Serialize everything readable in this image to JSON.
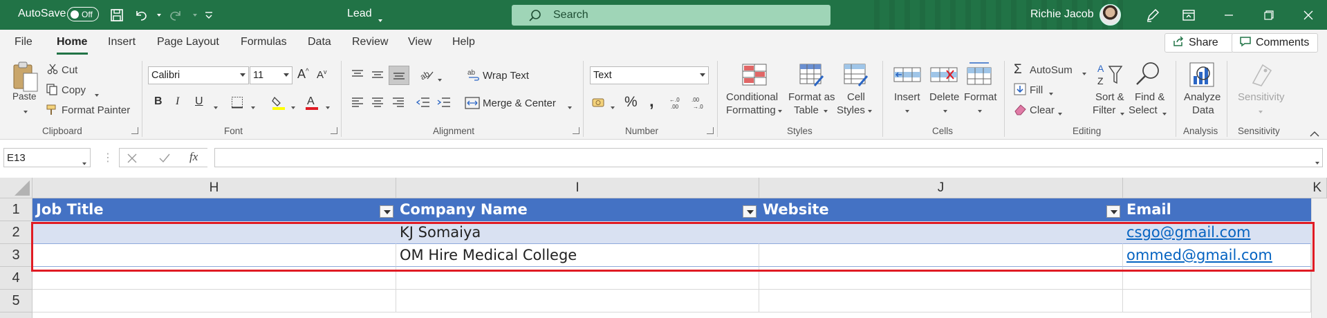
{
  "titlebar": {
    "autosave_label": "AutoSave",
    "autosave_state": "Off",
    "document_title": "Lead",
    "search_placeholder": "Search",
    "user_name": "Richie Jacob",
    "accent_color": "#217346"
  },
  "tabs": [
    "File",
    "Home",
    "Insert",
    "Page Layout",
    "Formulas",
    "Data",
    "Review",
    "View",
    "Help"
  ],
  "active_tab": "Home",
  "share_label": "Share",
  "comments_label": "Comments",
  "ribbon": {
    "clipboard": {
      "title": "Clipboard",
      "paste": "Paste",
      "cut": "Cut",
      "copy": "Copy",
      "format_painter": "Format Painter"
    },
    "font": {
      "title": "Font",
      "font_name": "Calibri",
      "font_size": "11"
    },
    "alignment": {
      "title": "Alignment",
      "wrap_text": "Wrap Text",
      "merge_center": "Merge & Center"
    },
    "number": {
      "title": "Number",
      "format": "Text"
    },
    "styles": {
      "title": "Styles",
      "conditional_1": "Conditional",
      "conditional_2": "Formatting",
      "format_table_1": "Format as",
      "format_table_2": "Table",
      "cell_styles_1": "Cell",
      "cell_styles_2": "Styles"
    },
    "cells": {
      "title": "Cells",
      "insert": "Insert",
      "delete": "Delete",
      "format": "Format"
    },
    "editing": {
      "title": "Editing",
      "autosum": "AutoSum",
      "fill": "Fill",
      "clear": "Clear",
      "sort_1": "Sort &",
      "sort_2": "Filter",
      "find_1": "Find &",
      "find_2": "Select"
    },
    "analysis": {
      "title": "Analysis",
      "analyze_1": "Analyze",
      "analyze_2": "Data"
    },
    "sensitivity": {
      "title": "Sensitivity",
      "label": "Sensitivity"
    }
  },
  "formula_bar": {
    "name_box": "E13",
    "formula": ""
  },
  "grid": {
    "columns": [
      "H",
      "I",
      "J",
      "K"
    ],
    "rows": [
      "1",
      "2",
      "3",
      "4",
      "5"
    ],
    "header_row": [
      "Job Title",
      "Company Name",
      "Website",
      "Email"
    ],
    "data_rows": [
      [
        "",
        "KJ Somaiya",
        "",
        "csgo@gmail.com"
      ],
      [
        "",
        "OM Hire Medical College",
        "",
        "ommed@gmail.com"
      ]
    ],
    "table_header_color": "#4472c4",
    "band_color": "#d9e1f2",
    "link_color": "#0563c1",
    "highlight_color": "#e01b24"
  }
}
